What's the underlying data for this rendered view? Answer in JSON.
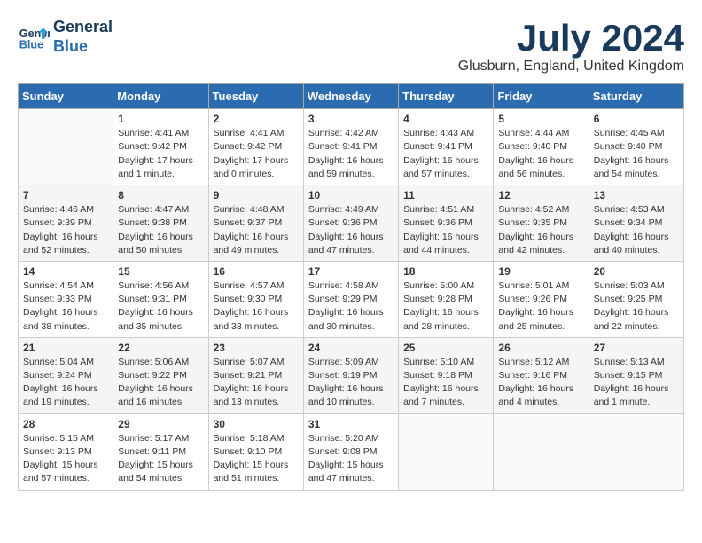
{
  "header": {
    "logo_line1": "General",
    "logo_line2": "Blue",
    "month_title": "July 2024",
    "location": "Glusburn, England, United Kingdom"
  },
  "days_of_week": [
    "Sunday",
    "Monday",
    "Tuesday",
    "Wednesday",
    "Thursday",
    "Friday",
    "Saturday"
  ],
  "weeks": [
    [
      {
        "day": "",
        "content": ""
      },
      {
        "day": "1",
        "content": "Sunrise: 4:41 AM\nSunset: 9:42 PM\nDaylight: 17 hours\nand 1 minute."
      },
      {
        "day": "2",
        "content": "Sunrise: 4:41 AM\nSunset: 9:42 PM\nDaylight: 17 hours\nand 0 minutes."
      },
      {
        "day": "3",
        "content": "Sunrise: 4:42 AM\nSunset: 9:41 PM\nDaylight: 16 hours\nand 59 minutes."
      },
      {
        "day": "4",
        "content": "Sunrise: 4:43 AM\nSunset: 9:41 PM\nDaylight: 16 hours\nand 57 minutes."
      },
      {
        "day": "5",
        "content": "Sunrise: 4:44 AM\nSunset: 9:40 PM\nDaylight: 16 hours\nand 56 minutes."
      },
      {
        "day": "6",
        "content": "Sunrise: 4:45 AM\nSunset: 9:40 PM\nDaylight: 16 hours\nand 54 minutes."
      }
    ],
    [
      {
        "day": "7",
        "content": "Sunrise: 4:46 AM\nSunset: 9:39 PM\nDaylight: 16 hours\nand 52 minutes."
      },
      {
        "day": "8",
        "content": "Sunrise: 4:47 AM\nSunset: 9:38 PM\nDaylight: 16 hours\nand 50 minutes."
      },
      {
        "day": "9",
        "content": "Sunrise: 4:48 AM\nSunset: 9:37 PM\nDaylight: 16 hours\nand 49 minutes."
      },
      {
        "day": "10",
        "content": "Sunrise: 4:49 AM\nSunset: 9:36 PM\nDaylight: 16 hours\nand 47 minutes."
      },
      {
        "day": "11",
        "content": "Sunrise: 4:51 AM\nSunset: 9:36 PM\nDaylight: 16 hours\nand 44 minutes."
      },
      {
        "day": "12",
        "content": "Sunrise: 4:52 AM\nSunset: 9:35 PM\nDaylight: 16 hours\nand 42 minutes."
      },
      {
        "day": "13",
        "content": "Sunrise: 4:53 AM\nSunset: 9:34 PM\nDaylight: 16 hours\nand 40 minutes."
      }
    ],
    [
      {
        "day": "14",
        "content": "Sunrise: 4:54 AM\nSunset: 9:33 PM\nDaylight: 16 hours\nand 38 minutes."
      },
      {
        "day": "15",
        "content": "Sunrise: 4:56 AM\nSunset: 9:31 PM\nDaylight: 16 hours\nand 35 minutes."
      },
      {
        "day": "16",
        "content": "Sunrise: 4:57 AM\nSunset: 9:30 PM\nDaylight: 16 hours\nand 33 minutes."
      },
      {
        "day": "17",
        "content": "Sunrise: 4:58 AM\nSunset: 9:29 PM\nDaylight: 16 hours\nand 30 minutes."
      },
      {
        "day": "18",
        "content": "Sunrise: 5:00 AM\nSunset: 9:28 PM\nDaylight: 16 hours\nand 28 minutes."
      },
      {
        "day": "19",
        "content": "Sunrise: 5:01 AM\nSunset: 9:26 PM\nDaylight: 16 hours\nand 25 minutes."
      },
      {
        "day": "20",
        "content": "Sunrise: 5:03 AM\nSunset: 9:25 PM\nDaylight: 16 hours\nand 22 minutes."
      }
    ],
    [
      {
        "day": "21",
        "content": "Sunrise: 5:04 AM\nSunset: 9:24 PM\nDaylight: 16 hours\nand 19 minutes."
      },
      {
        "day": "22",
        "content": "Sunrise: 5:06 AM\nSunset: 9:22 PM\nDaylight: 16 hours\nand 16 minutes."
      },
      {
        "day": "23",
        "content": "Sunrise: 5:07 AM\nSunset: 9:21 PM\nDaylight: 16 hours\nand 13 minutes."
      },
      {
        "day": "24",
        "content": "Sunrise: 5:09 AM\nSunset: 9:19 PM\nDaylight: 16 hours\nand 10 minutes."
      },
      {
        "day": "25",
        "content": "Sunrise: 5:10 AM\nSunset: 9:18 PM\nDaylight: 16 hours\nand 7 minutes."
      },
      {
        "day": "26",
        "content": "Sunrise: 5:12 AM\nSunset: 9:16 PM\nDaylight: 16 hours\nand 4 minutes."
      },
      {
        "day": "27",
        "content": "Sunrise: 5:13 AM\nSunset: 9:15 PM\nDaylight: 16 hours\nand 1 minute."
      }
    ],
    [
      {
        "day": "28",
        "content": "Sunrise: 5:15 AM\nSunset: 9:13 PM\nDaylight: 15 hours\nand 57 minutes."
      },
      {
        "day": "29",
        "content": "Sunrise: 5:17 AM\nSunset: 9:11 PM\nDaylight: 15 hours\nand 54 minutes."
      },
      {
        "day": "30",
        "content": "Sunrise: 5:18 AM\nSunset: 9:10 PM\nDaylight: 15 hours\nand 51 minutes."
      },
      {
        "day": "31",
        "content": "Sunrise: 5:20 AM\nSunset: 9:08 PM\nDaylight: 15 hours\nand 47 minutes."
      },
      {
        "day": "",
        "content": ""
      },
      {
        "day": "",
        "content": ""
      },
      {
        "day": "",
        "content": ""
      }
    ]
  ]
}
